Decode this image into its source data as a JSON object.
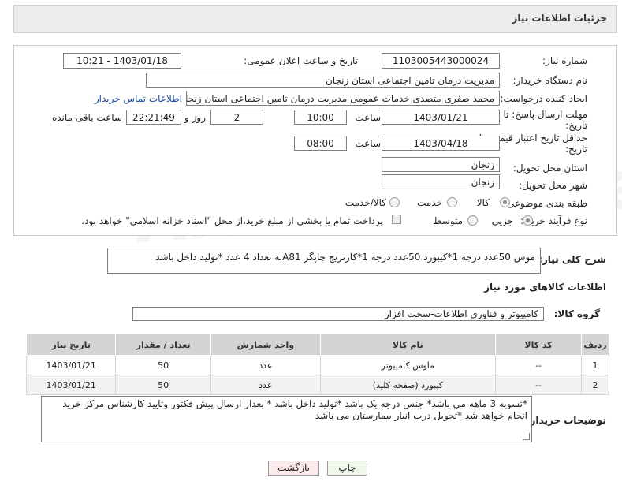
{
  "header": {
    "title": "جزئیات اطلاعات نیاز"
  },
  "form": {
    "need_number": {
      "label": "شماره نیاز:",
      "value": "1103005443000024"
    },
    "announce_datetime": {
      "label": "تاریخ و ساعت اعلان عمومی:",
      "value": "1403/01/18 - 10:21"
    },
    "buyer_org": {
      "label": "نام دستگاه خریدار:",
      "value": "مدیریت درمان تامین اجتماعی استان زنجان"
    },
    "requester": {
      "label": "ایجاد کننده درخواست:",
      "value": "محمد صفری متصدی خدمات عمومی مدیریت درمان تامین اجتماعی استان زنجان",
      "contact_link": "اطلاعات تماس خریدار"
    },
    "deadline": {
      "label_line1": "مهلت ارسال پاسخ: تا",
      "label_line2": "تاریخ:",
      "date": "1403/01/21",
      "time_label": "ساعت",
      "time": "10:00",
      "days": "2",
      "days_label": "روز و",
      "remaining": "22:21:49",
      "remaining_label": "ساعت باقی مانده"
    },
    "validity": {
      "label_line1": "حداقل تاریخ اعتبار قیمت: تا",
      "label_line2": "تاریخ:",
      "date": "1403/04/18",
      "time_label": "ساعت",
      "time": "08:00"
    },
    "province": {
      "label": "استان محل تحویل:",
      "value": "زنجان"
    },
    "city": {
      "label": "شهر محل تحویل:",
      "value": "زنجان"
    },
    "category": {
      "label": "طبقه بندی موضوعی:",
      "options": [
        "کالا",
        "خدمت",
        "کالا/خدمت"
      ],
      "selected": 0
    },
    "purchase_type": {
      "label": "نوع فرآیند خرید :",
      "options": [
        "جزیی",
        "متوسط"
      ],
      "selected": 0,
      "treasury_note": "پرداخت تمام یا بخشی از مبلغ خرید،از محل \"اسناد خزانه اسلامی\" خواهد بود."
    }
  },
  "description": {
    "label": "شرح کلی نیاز:",
    "value": "موس 50عدد درجه 1*کیبورد 50عدد درجه 1*کارتریج چاپگر A81به تعداد 4 عدد *تولید داخل باشد"
  },
  "goods_section": {
    "title": "اطلاعات کالاهای مورد نیاز",
    "group_label": "گروه کالا:",
    "group_value": "کامپیوتر و فناوری اطلاعات-سخت افزار",
    "table": {
      "headers": [
        "ردیف",
        "کد کالا",
        "نام کالا",
        "واحد شمارش",
        "تعداد / مقدار",
        "تاریخ نیاز"
      ],
      "rows": [
        [
          "1",
          "--",
          "ماوس کامپیوتر",
          "عدد",
          "50",
          "1403/01/21"
        ],
        [
          "2",
          "--",
          "کیبورد (صفحه کلید)",
          "عدد",
          "50",
          "1403/01/21"
        ]
      ]
    }
  },
  "buyer_notes": {
    "label": "توضیحات خریدار:",
    "value": "*تسویه 3 ماهه می باشد* جنس درجه یک باشد *تولید داخل باشد * بعداز ارسال پیش فکتور وتایید کارشناس مرکز خرید انجام خواهد شد *تحویل درب انبار بیمارستان می باشد"
  },
  "buttons": {
    "print": "چاپ",
    "back": "بازگشت"
  },
  "watermark": "AriaTender.neT"
}
